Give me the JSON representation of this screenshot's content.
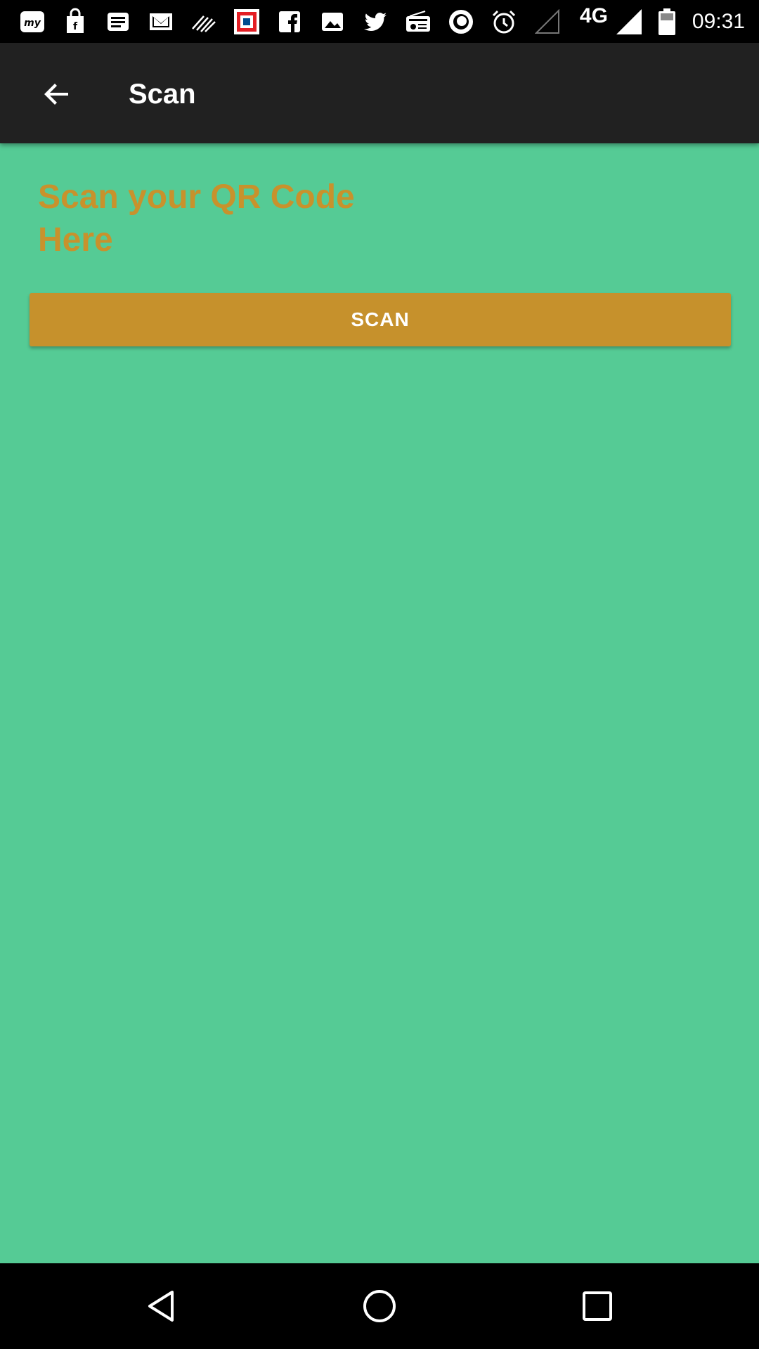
{
  "status_bar": {
    "network_type": "4G",
    "time": "09:31",
    "notification_icons": [
      "myntra-icon",
      "shopping-bag-icon",
      "news-icon",
      "gmail-icon",
      "stripes-icon",
      "hdfc-icon",
      "facebook-icon",
      "gallery-icon",
      "twitter-icon",
      "radio-icon",
      "circle-app-icon",
      "alarm-icon"
    ]
  },
  "app_bar": {
    "title": "Scan",
    "back_icon": "arrow-back-icon"
  },
  "content": {
    "heading": "Scan your QR Code Here",
    "scan_button_label": "SCAN"
  },
  "colors": {
    "background": "#55cb95",
    "app_bar": "#212121",
    "accent": "#c6912c"
  },
  "nav_bar": {
    "icons": [
      "nav-back-icon",
      "nav-home-icon",
      "nav-recents-icon"
    ]
  }
}
